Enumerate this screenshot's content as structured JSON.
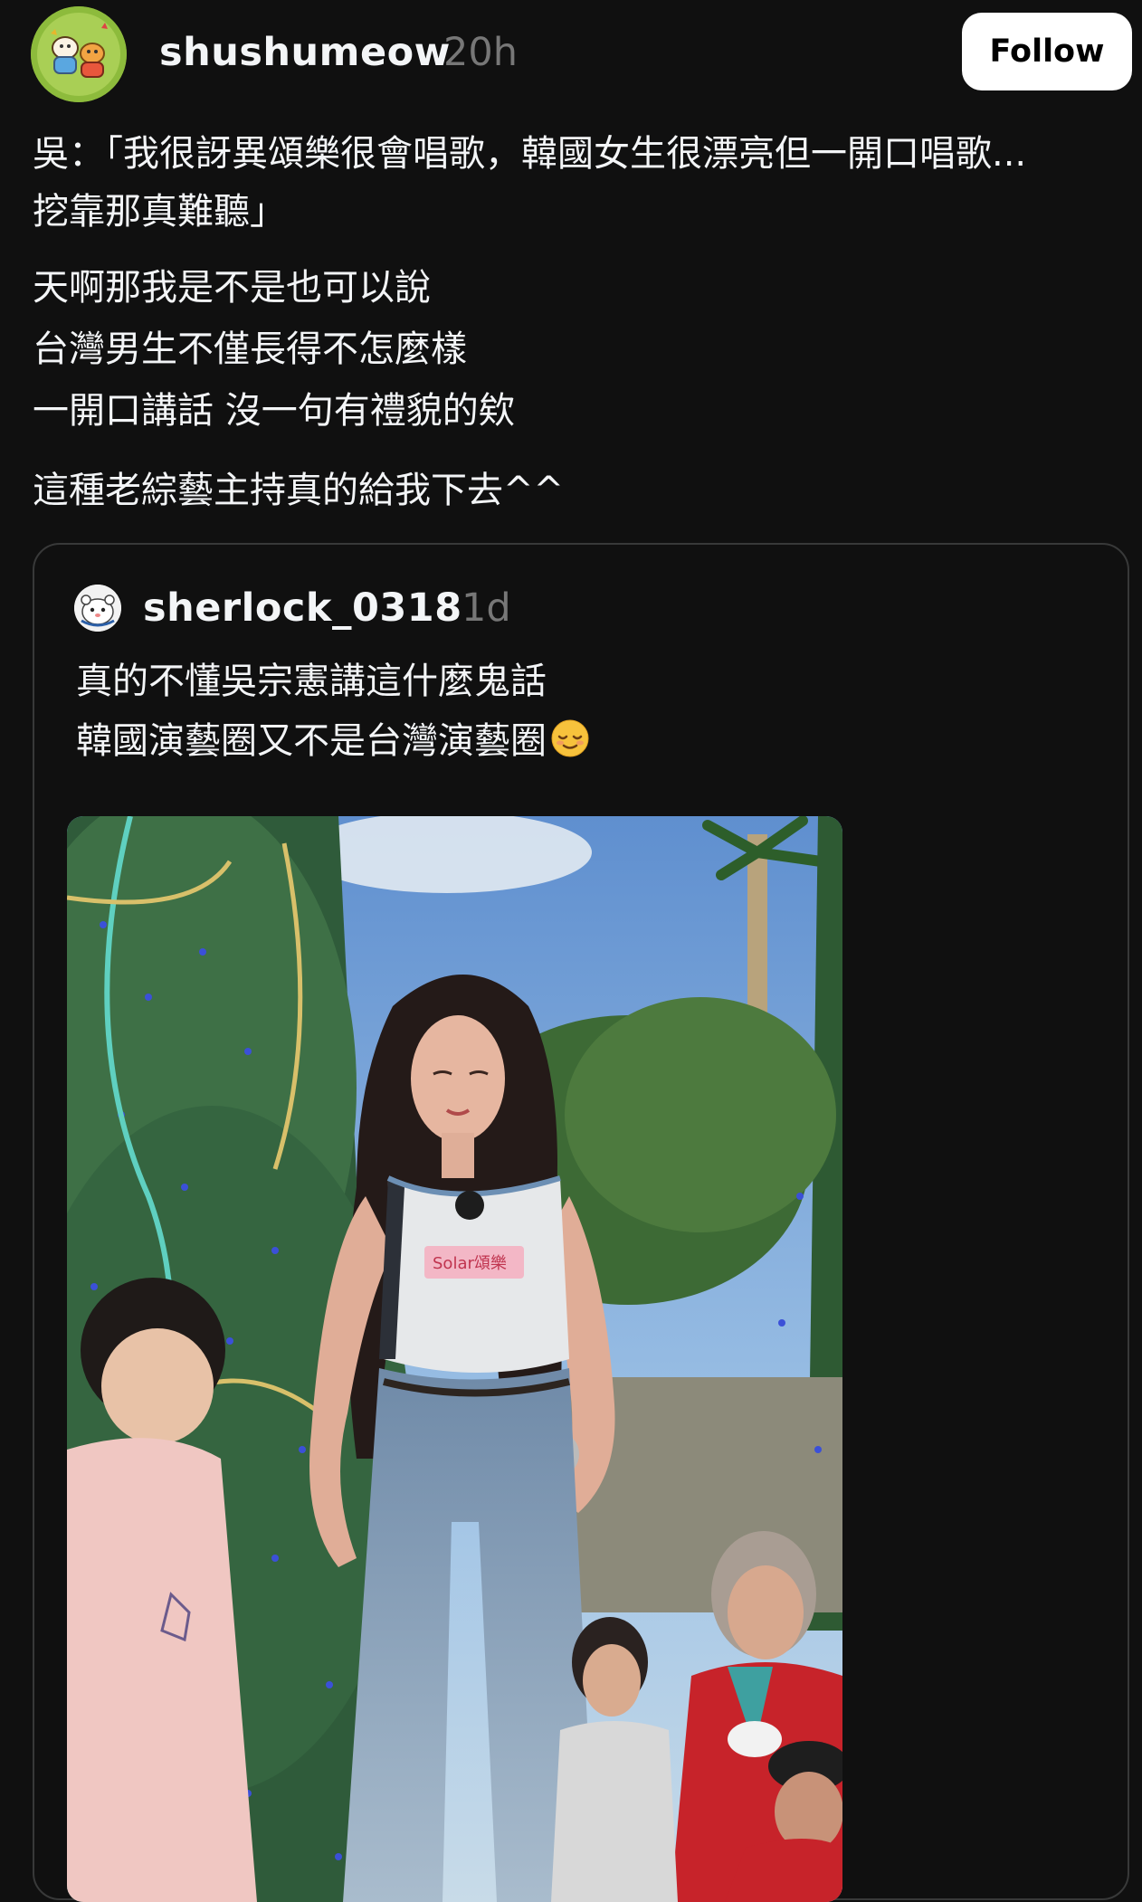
{
  "post": {
    "author": "shushumeow",
    "time": "20h",
    "follow_label": "Follow",
    "paragraphs": [
      [
        "吳：「我很訝異頌樂很會唱歌，韓國女生很漂亮但一開口唱歌...",
        "挖靠那真難聽」"
      ],
      [
        "天啊那我是不是也可以說",
        "台灣男生不僅長得不怎麼樣",
        "一開口講話  沒一句有禮貌的欸"
      ],
      [
        "這種老綜藝主持真的給我下去^^"
      ]
    ]
  },
  "quoted_post": {
    "author": "sherlock_0318",
    "time": "1d",
    "lines": [
      "真的不懂吳宗憲講這什麼鬼話",
      "韓國演藝圈又不是台灣演藝圈"
    ],
    "emoji": "relieved-face-emoji",
    "media_label": "Solar頌樂"
  },
  "colors": {
    "background": "#101010",
    "text": "#f3f5f7",
    "muted": "#777777",
    "card_border": "#383939",
    "button_bg": "#ffffff"
  }
}
